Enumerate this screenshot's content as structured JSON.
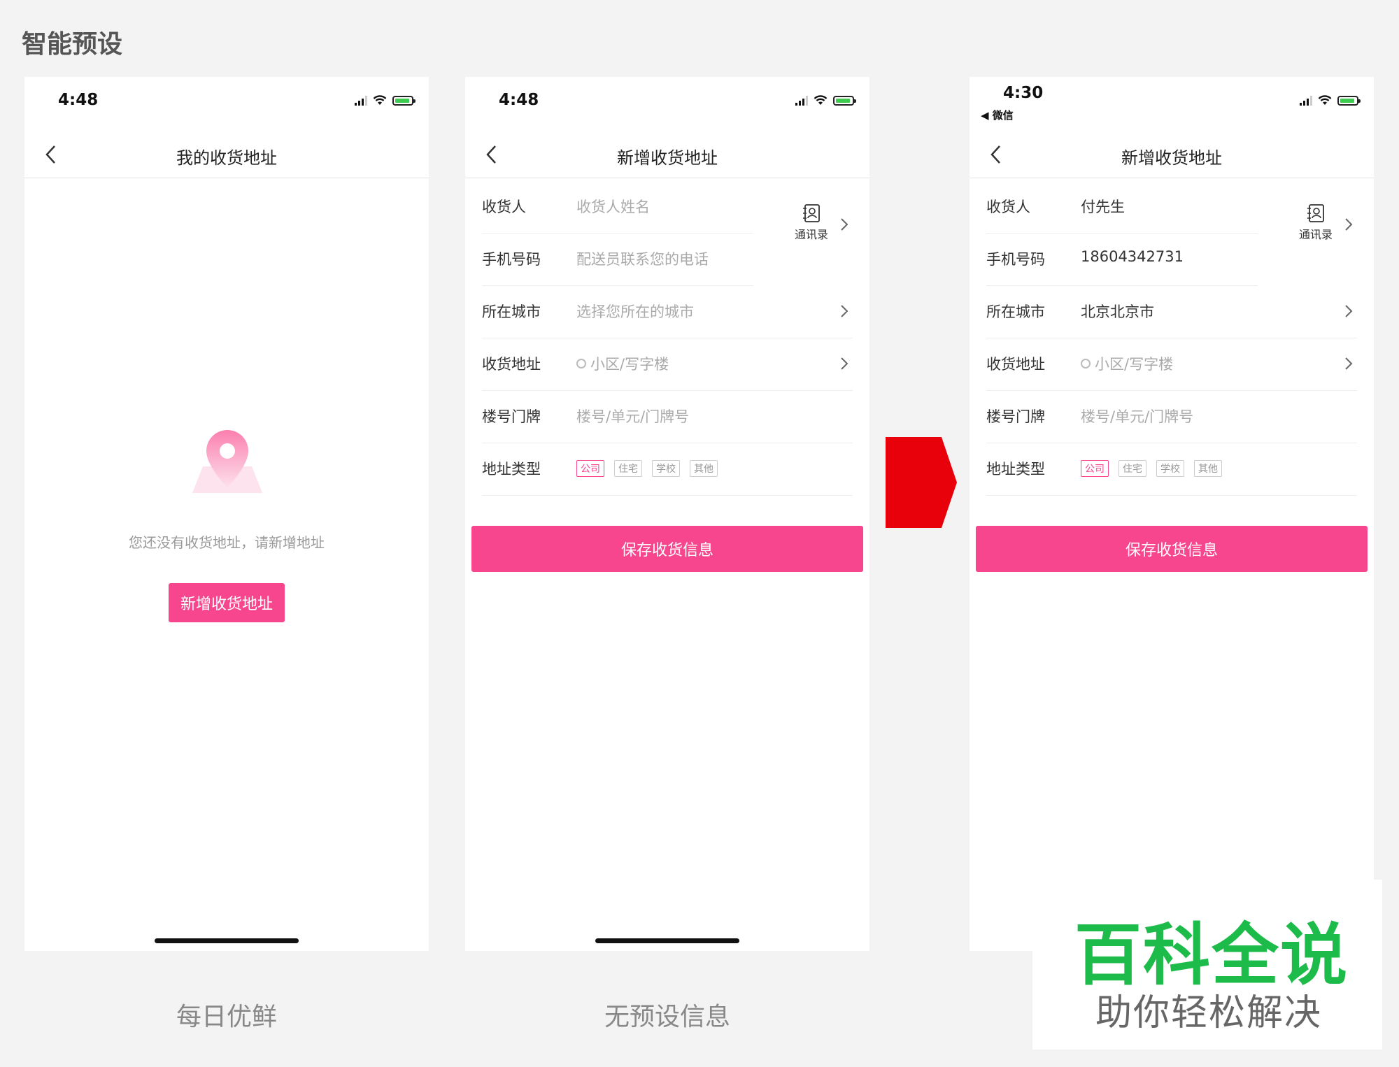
{
  "page_title": "智能预设",
  "phones": [
    {
      "time": "4:48",
      "nav_title": "我的收货地址",
      "empty_text": "您还没有收货地址，请新增地址",
      "add_button": "新增收货地址",
      "caption": "每日优鲜"
    },
    {
      "time": "4:48",
      "nav_title": "新增收货地址",
      "rows": [
        {
          "label": "收货人",
          "value": "收货人姓名"
        },
        {
          "label": "手机号码",
          "value": "配送员联系您的电话"
        },
        {
          "label": "所在城市",
          "value": "选择您所在的城市"
        },
        {
          "label": "收货地址",
          "value": "小区/写字楼"
        },
        {
          "label": "楼号门牌",
          "value": "楼号/单元/门牌号"
        },
        {
          "label": "地址类型"
        }
      ],
      "contacts_label": "通讯录",
      "tags": [
        "公司",
        "住宅",
        "学校",
        "其他"
      ],
      "save_button": "保存收货信息",
      "caption": "无预设信息"
    },
    {
      "time": "4:30",
      "back_app": "◀ 微信",
      "nav_title": "新增收货地址",
      "rows": [
        {
          "label": "收货人",
          "value": "付先生"
        },
        {
          "label": "手机号码",
          "value": "18604342731"
        },
        {
          "label": "所在城市",
          "value": "北京北京市"
        },
        {
          "label": "收货地址",
          "value": "小区/写字楼"
        },
        {
          "label": "楼号门牌",
          "value": "楼号/单元/门牌号"
        },
        {
          "label": "地址类型"
        }
      ],
      "contacts_label": "通讯录",
      "tags": [
        "公司",
        "住宅",
        "学校",
        "其他"
      ],
      "save_button": "保存收货信息"
    }
  ],
  "watermark": {
    "title": "百科全说",
    "subtitle": "助你轻松解决"
  },
  "colors": {
    "accent": "#f7468e",
    "arrow": "#e8000b",
    "watermark_green": "#1dbb4a"
  }
}
